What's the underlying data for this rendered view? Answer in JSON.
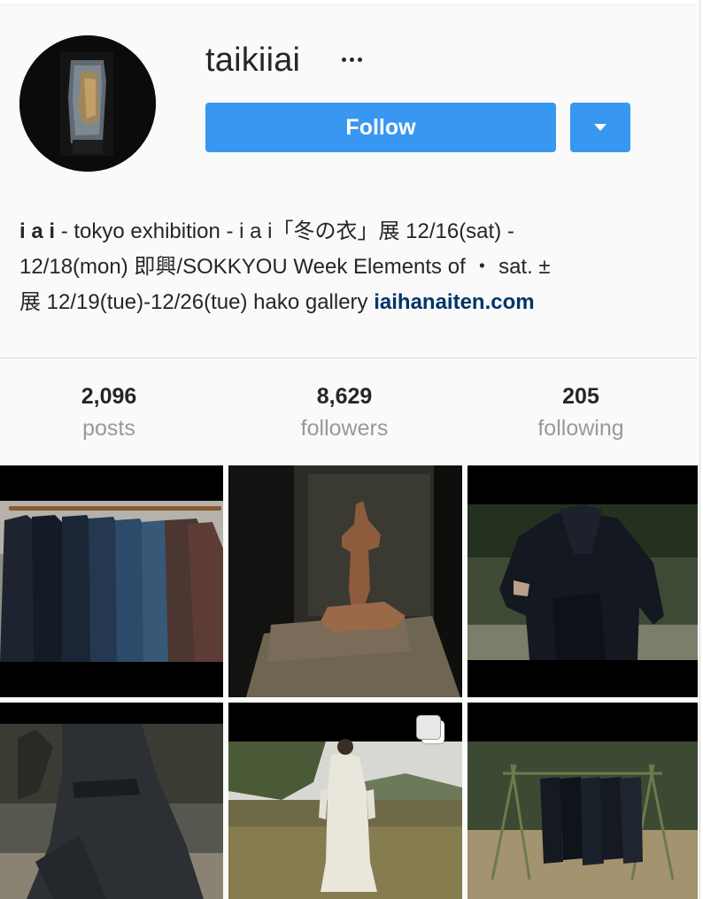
{
  "profile": {
    "username": "taikiiai",
    "follow_label": "Follow",
    "bio": {
      "name": "i a i",
      "line1_rest": " - tokyo exhibition - i a i「冬の衣」展 12/16(sat) -",
      "line2": "12/18(mon) 即興/SOKKYOU Week Elements of ・ sat. ±",
      "line3_text": "展 12/19(tue)-12/26(tue) hako gallery ",
      "link": "iaihanaiten.com"
    }
  },
  "stats": {
    "posts": {
      "value": "2,096",
      "label": "posts"
    },
    "followers": {
      "value": "8,629",
      "label": "followers"
    },
    "following": {
      "value": "205",
      "label": "following"
    }
  },
  "colors": {
    "accent": "#3897f0",
    "link": "#003569",
    "muted": "#999999",
    "text": "#262626",
    "background": "#fafafa"
  },
  "icons": {
    "more": "more-options-icon",
    "dropdown": "chevron-down-icon",
    "multi_post": "multiple-posts-icon"
  },
  "posts": [
    {
      "subject": "jackets-on-rack"
    },
    {
      "subject": "clay-figure"
    },
    {
      "subject": "dark-coat-forest"
    },
    {
      "subject": "dark-dress-twirl"
    },
    {
      "subject": "white-dress-field"
    },
    {
      "subject": "clothes-on-poles"
    }
  ]
}
